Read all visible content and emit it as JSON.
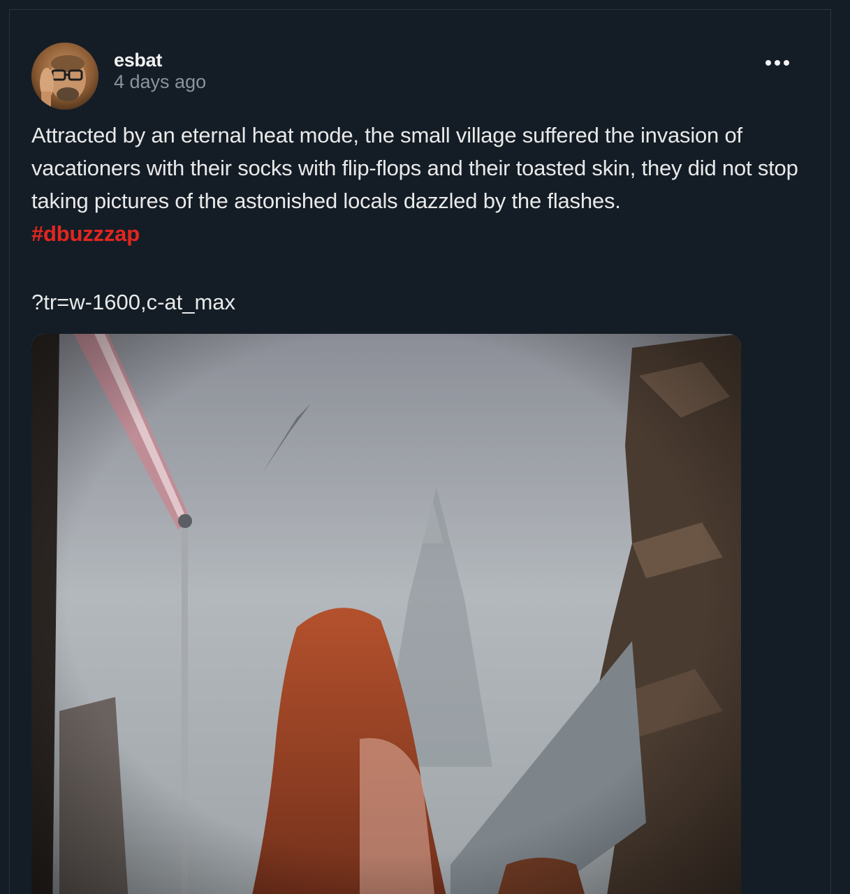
{
  "post": {
    "author": "esbat",
    "timestamp": "4 days ago",
    "body": "Attracted by an eternal heat mode, the small village suffered the invasion of vacationers with their socks with flip-flops and their toasted skin, they did not stop taking pictures of the astonished locals dazzled by the flashes.",
    "hashtag": "#dbuzzzap",
    "image_query": "?tr=w-1600,c-at_max",
    "more_icon": "more-horizontal-icon"
  },
  "colors": {
    "background": "#141d26",
    "hashtag": "#e3261f",
    "muted_text": "#8a939c"
  }
}
